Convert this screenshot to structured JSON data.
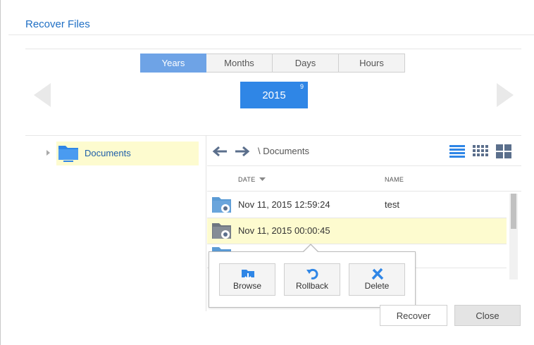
{
  "dialog": {
    "title": "Recover Files"
  },
  "timeline": {
    "tabs": [
      {
        "label": "Years",
        "active": true
      },
      {
        "label": "Months",
        "active": false
      },
      {
        "label": "Days",
        "active": false
      },
      {
        "label": "Hours",
        "active": false
      }
    ],
    "selected_year": "2015",
    "snapshot_count": "9"
  },
  "tree": {
    "items": [
      {
        "label": "Documents",
        "icon": "folder-icon",
        "selected": true
      }
    ]
  },
  "browser": {
    "path": "\\ Documents",
    "columns": {
      "date": "DATE",
      "name": "NAME"
    },
    "rows": [
      {
        "date": "Nov 11, 2015 12:59:24",
        "name": "test",
        "selected": false
      },
      {
        "date": "Nov 11, 2015 00:00:45",
        "name": "",
        "selected": true
      }
    ]
  },
  "context_menu": {
    "browse": "Browse",
    "rollback": "Rollback",
    "delete": "Delete"
  },
  "footer": {
    "recover": "Recover",
    "close": "Close"
  },
  "colors": {
    "accent": "#2f86e6",
    "title": "#1f6fc4",
    "selection": "#fdfbcf",
    "icon": "#5b6f8c"
  }
}
